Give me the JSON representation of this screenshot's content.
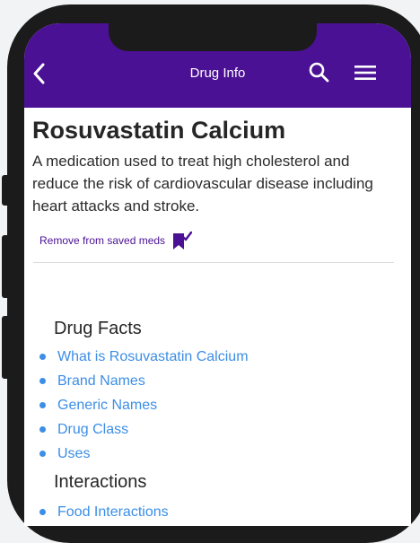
{
  "header": {
    "title": "Drug Info",
    "accent_color": "#4b1195",
    "back_icon": "chevron-left-icon",
    "search_icon": "search-icon",
    "menu_icon": "hamburger-menu-icon"
  },
  "drug": {
    "name": "Rosuvastatin Calcium",
    "description": "A medication used to treat high cholesterol and reduce the risk of cardiovascular disease including heart attacks and stroke."
  },
  "save": {
    "label": "Remove from saved meds",
    "icon": "bookmark-check-icon"
  },
  "sections": [
    {
      "title": "Drug Facts",
      "links": [
        "What is Rosuvastatin Calcium",
        "Brand Names",
        "Generic Names",
        "Drug Class",
        "Uses"
      ]
    },
    {
      "title": "Interactions",
      "links": [
        "Food Interactions"
      ]
    }
  ],
  "link_color": "#3c8ee6"
}
